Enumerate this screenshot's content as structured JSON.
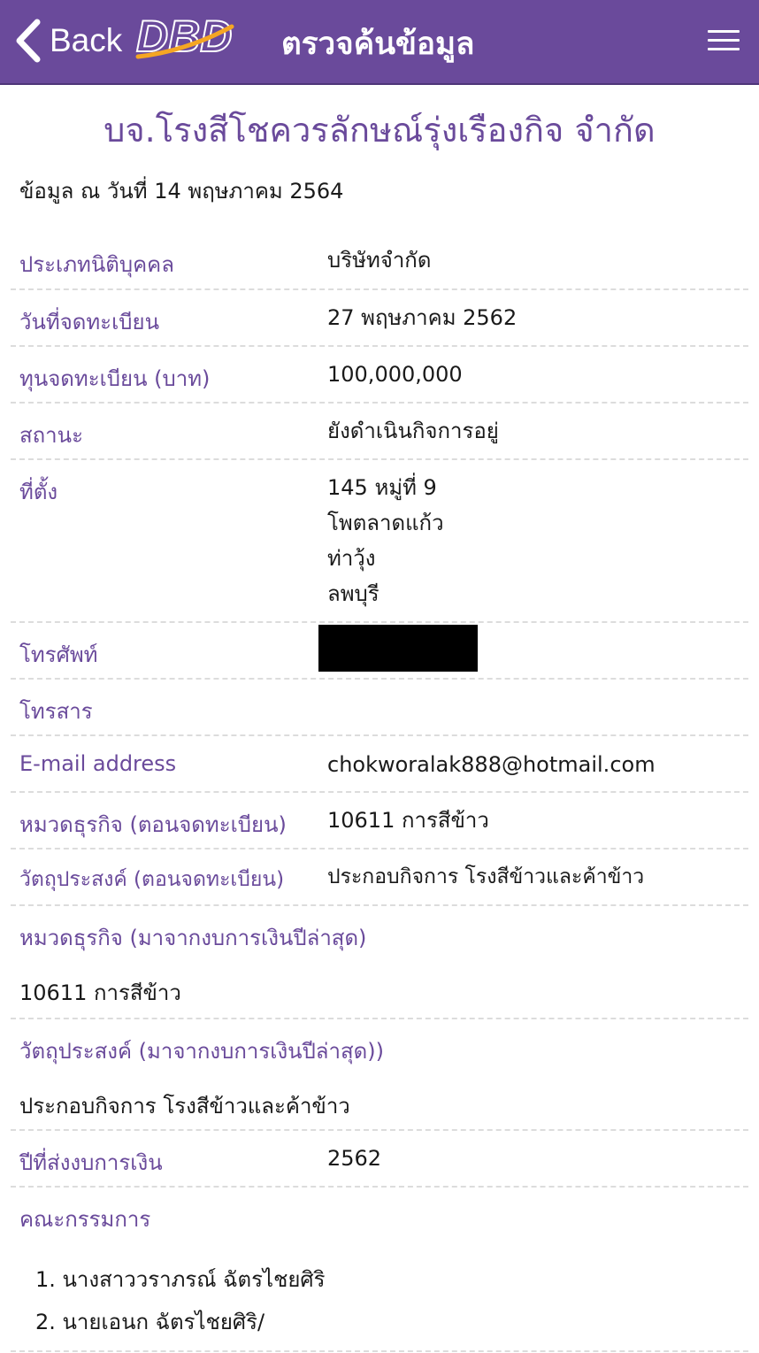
{
  "header": {
    "back_label": "Back",
    "logo_text": "DBD",
    "title": "ตรวจค้นข้อมูล",
    "colors": {
      "bar": "#6a4a9b",
      "accent": "#f5a623"
    }
  },
  "company_name": "บจ.โรงสีโชควรลักษณ์รุ่งเรืองกิจ จำกัด",
  "as_of": "ข้อมูล ณ วันที่ 14 พฤษภาคม 2564",
  "fields": {
    "type": {
      "label": "ประเภทนิติบุคคล",
      "value": "บริษัทจำกัด"
    },
    "reg_date": {
      "label": "วันที่จดทะเบียน",
      "value": "27 พฤษภาคม 2562"
    },
    "capital": {
      "label": "ทุนจดทะเบียน (บาท)",
      "value": "100,000,000"
    },
    "status": {
      "label": "สถานะ",
      "value": "ยังดำเนินกิจการอยู่"
    },
    "address": {
      "label": "ที่ตั้ง",
      "lines": [
        "145 หมู่ที่ 9",
        "โพตลาดแก้ว",
        "ท่าวุ้ง",
        "ลพบุรี"
      ]
    },
    "phone": {
      "label": "โทรศัพท์"
    },
    "fax": {
      "label": "โทรสาร"
    },
    "email": {
      "label": "E-mail address",
      "value": "chokworalak888@hotmail.com"
    },
    "business_reg": {
      "label": "หมวดธุรกิจ (ตอนจดทะเบียน)",
      "value": "10611 การสีข้าว"
    },
    "objective_reg": {
      "label": "วัตถุประสงค์ (ตอนจดทะเบียน)",
      "value": "ประกอบกิจการ โรงสีข้าวและค้าข้าว"
    },
    "business_latest": {
      "label": "หมวดธุรกิจ (มาจากงบการเงินปีล่าสุด)",
      "value": "10611 การสีข้าว"
    },
    "objective_latest": {
      "label": "วัตถุประสงค์ (มาจากงบการเงินปีล่าสุด))",
      "value": "ประกอบกิจการ โรงสีข้าวและค้าข้าว"
    },
    "fin_year": {
      "label": "ปีที่ส่งงบการเงิน",
      "value": "2562"
    },
    "directors": {
      "label": "คณะกรรมการ",
      "items": [
        "1. นางสาววราภรณ์ ฉัตรไชยศิริ",
        "2. นายเอนก ฉัตรไชยศิริ/"
      ]
    }
  }
}
